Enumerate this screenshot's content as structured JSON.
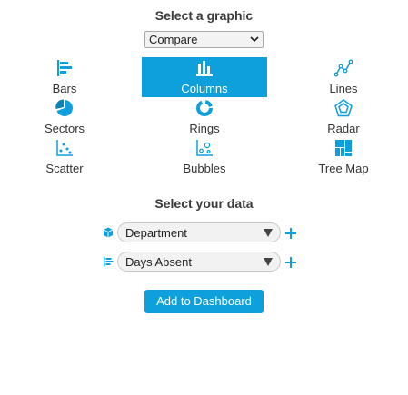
{
  "graphic_section": {
    "title": "Select a graphic"
  },
  "compare_select": {
    "value": "Compare"
  },
  "graphics": [
    {
      "id": "bars",
      "label": "Bars",
      "icon": "bars-icon",
      "selected": false
    },
    {
      "id": "columns",
      "label": "Columns",
      "icon": "columns-icon",
      "selected": true
    },
    {
      "id": "lines",
      "label": "Lines",
      "icon": "lines-icon",
      "selected": false
    },
    {
      "id": "sectors",
      "label": "Sectors",
      "icon": "sectors-icon",
      "selected": false
    },
    {
      "id": "rings",
      "label": "Rings",
      "icon": "rings-icon",
      "selected": false
    },
    {
      "id": "radar",
      "label": "Radar",
      "icon": "radar-icon",
      "selected": false
    },
    {
      "id": "scatter",
      "label": "Scatter",
      "icon": "scatter-icon",
      "selected": false
    },
    {
      "id": "bubbles",
      "label": "Bubbles",
      "icon": "bubbles-icon",
      "selected": false
    },
    {
      "id": "treemap",
      "label": "Tree Map",
      "icon": "tree-map-icon",
      "selected": false
    }
  ],
  "data_section": {
    "title": "Select your data",
    "fields": [
      {
        "value": "Department",
        "icon": "cube-icon"
      },
      {
        "value": "Days Absent",
        "icon": "measure-icon"
      }
    ]
  },
  "add_button": {
    "label": "Add to Dashboard"
  },
  "colors": {
    "accent": "#0ea0dd",
    "selected_text": "#ffffff"
  }
}
